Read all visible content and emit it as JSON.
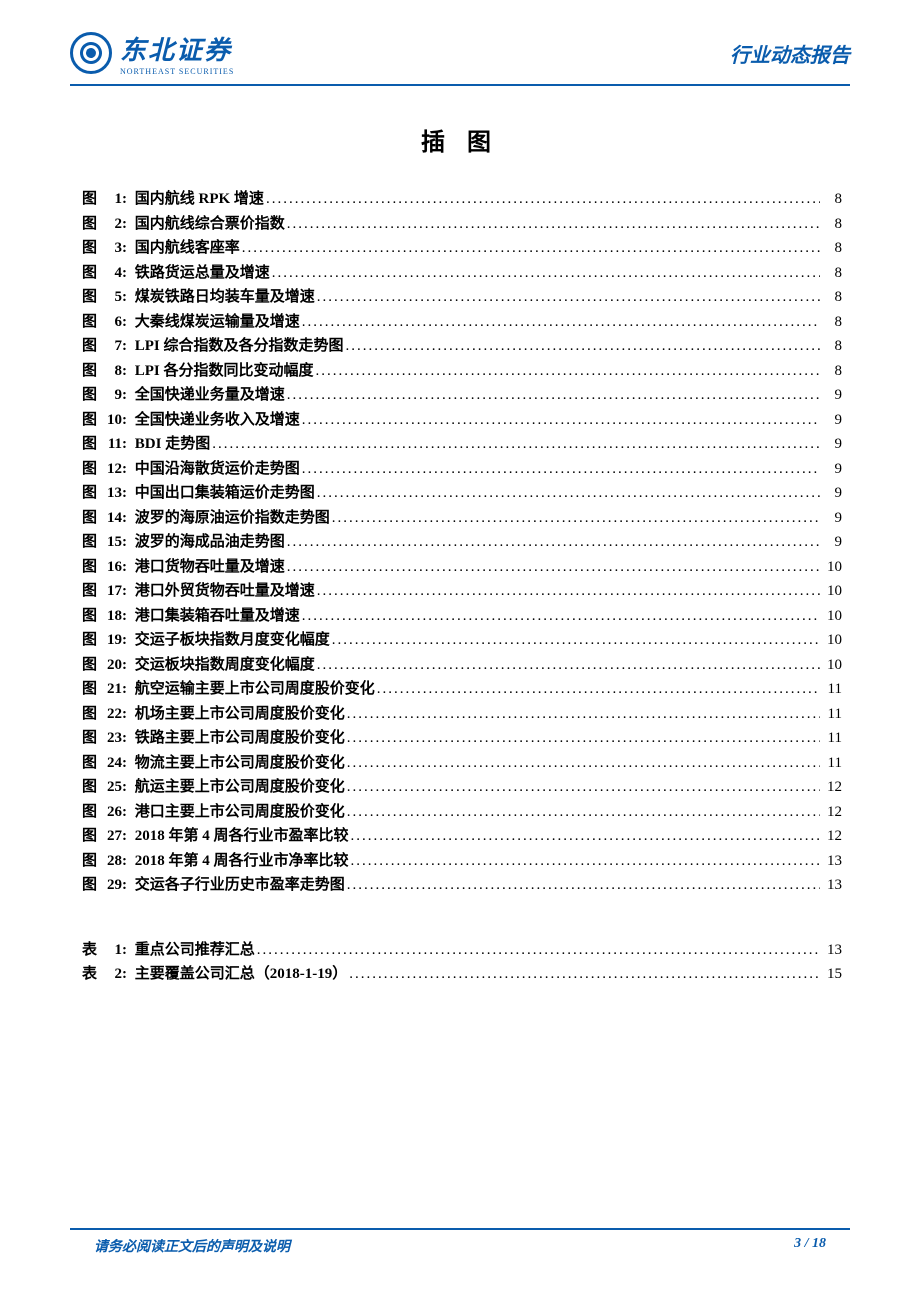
{
  "header": {
    "logo_cn": "东北证券",
    "logo_en": "NORTHEAST SECURITIES",
    "right_text": "行业动态报告"
  },
  "title": "插 图",
  "figures": [
    {
      "num": "1:",
      "label": "国内航线 RPK 增速",
      "page": "8"
    },
    {
      "num": "2:",
      "label": "国内航线综合票价指数",
      "page": "8"
    },
    {
      "num": "3:",
      "label": "国内航线客座率",
      "page": "8"
    },
    {
      "num": "4:",
      "label": "铁路货运总量及增速",
      "page": "8"
    },
    {
      "num": "5:",
      "label": "煤炭铁路日均装车量及增速",
      "page": "8"
    },
    {
      "num": "6:",
      "label": "大秦线煤炭运输量及增速",
      "page": "8"
    },
    {
      "num": "7:",
      "label": "LPI 综合指数及各分指数走势图",
      "page": "8"
    },
    {
      "num": "8:",
      "label": "LPI 各分指数同比变动幅度",
      "page": "8"
    },
    {
      "num": "9:",
      "label": "全国快递业务量及增速",
      "page": "9"
    },
    {
      "num": "10:",
      "label": "全国快递业务收入及增速",
      "page": "9"
    },
    {
      "num": "11:",
      "label": "BDI 走势图",
      "page": "9"
    },
    {
      "num": "12:",
      "label": "中国沿海散货运价走势图",
      "page": "9"
    },
    {
      "num": "13:",
      "label": "中国出口集装箱运价走势图",
      "page": "9"
    },
    {
      "num": "14:",
      "label": "波罗的海原油运价指数走势图",
      "page": "9"
    },
    {
      "num": "15:",
      "label": "波罗的海成品油走势图",
      "page": "9"
    },
    {
      "num": "16:",
      "label": "港口货物吞吐量及增速",
      "page": "10"
    },
    {
      "num": "17:",
      "label": "港口外贸货物吞吐量及增速",
      "page": "10"
    },
    {
      "num": "18:",
      "label": "港口集装箱吞吐量及增速",
      "page": "10"
    },
    {
      "num": "19:",
      "label": "交运子板块指数月度变化幅度",
      "page": "10"
    },
    {
      "num": "20:",
      "label": "交运板块指数周度变化幅度",
      "page": "10"
    },
    {
      "num": "21:",
      "label": "航空运输主要上市公司周度股价变化",
      "page": "11"
    },
    {
      "num": "22:",
      "label": "机场主要上市公司周度股价变化",
      "page": "11"
    },
    {
      "num": "23:",
      "label": "铁路主要上市公司周度股价变化",
      "page": "11"
    },
    {
      "num": "24:",
      "label": "物流主要上市公司周度股价变化",
      "page": "11"
    },
    {
      "num": "25:",
      "label": "航运主要上市公司周度股价变化",
      "page": "12"
    },
    {
      "num": "26:",
      "label": "港口主要上市公司周度股价变化",
      "page": "12"
    },
    {
      "num": "27:",
      "label": "2018 年第 4 周各行业市盈率比较",
      "page": "12"
    },
    {
      "num": "28:",
      "label": "2018 年第 4 周各行业市净率比较",
      "page": "13"
    },
    {
      "num": "29:",
      "label": "交运各子行业历史市盈率走势图",
      "page": "13"
    }
  ],
  "figure_prefix": "图",
  "table_prefix": "表",
  "tables": [
    {
      "num": "1:",
      "label": "重点公司推荐汇总",
      "page": "13"
    },
    {
      "num": "2:",
      "label": "主要覆盖公司汇总（2018-1-19）",
      "page": "15"
    }
  ],
  "footer": {
    "left": "请务必阅读正文后的声明及说明",
    "right": "3 / 18"
  }
}
